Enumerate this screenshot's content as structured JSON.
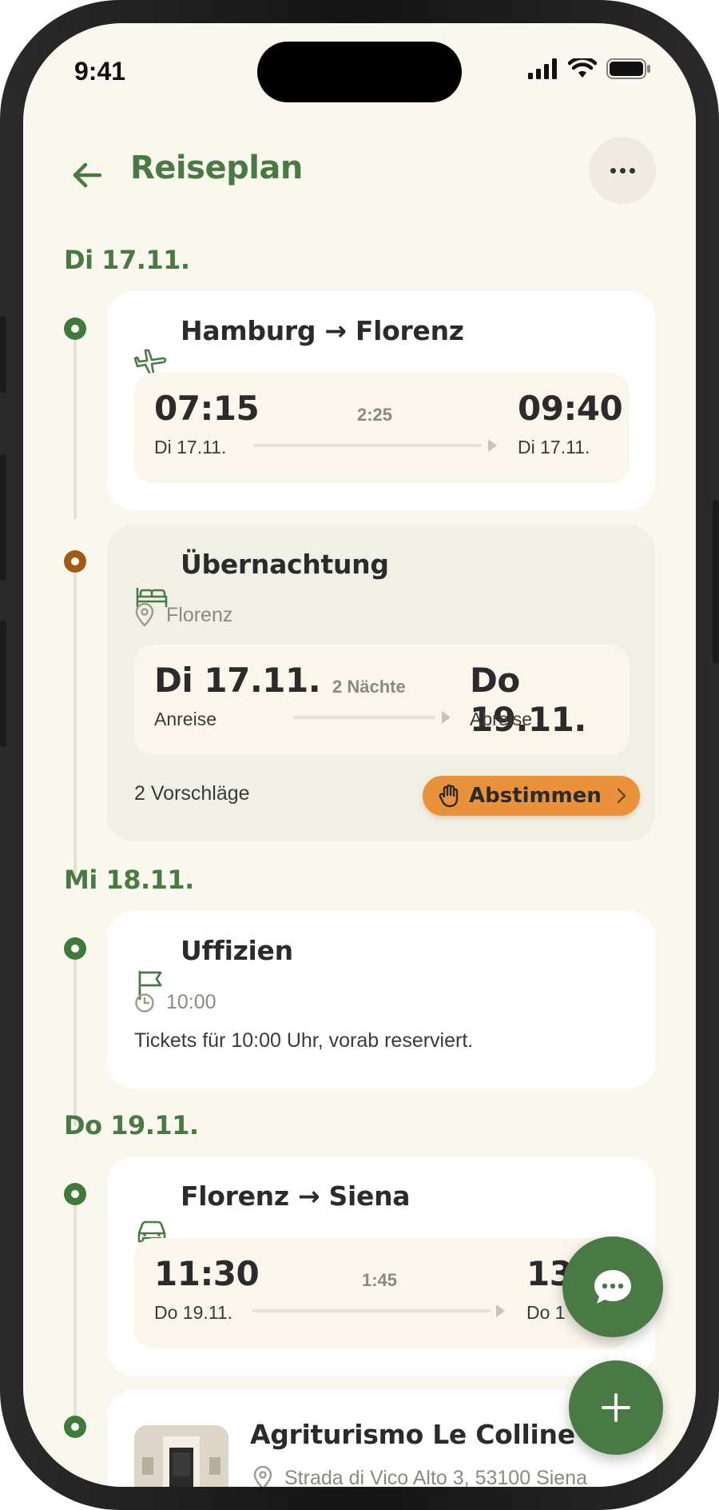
{
  "status": {
    "time": "9:41"
  },
  "header": {
    "title": "Reiseplan"
  },
  "days": [
    {
      "label": "Di 17.11."
    },
    {
      "label": "Mi 18.11."
    },
    {
      "label": "Do 19.11."
    }
  ],
  "items": {
    "flight": {
      "title": "Hamburg → Florenz",
      "icon": "plane-icon",
      "dep_time": "07:15",
      "dep_date": "Di 17.11.",
      "duration": "2:25",
      "arr_time": "09:40",
      "arr_date": "Di 17.11."
    },
    "stay": {
      "title": "Übernachtung",
      "icon": "bed-icon",
      "location": "Florenz",
      "checkin_date": "Di 17.11.",
      "checkin_label": "Anreise",
      "nights": "2 Nächte",
      "checkout_date": "Do 19.11.",
      "checkout_label": "Abreise",
      "suggestions": "2 Vorschläge",
      "vote_label": "Abstimmen"
    },
    "museum": {
      "title": "Uffizien",
      "icon": "flag-icon",
      "time": "10:00",
      "note": "Tickets für 10:00 Uhr, vorab reserviert."
    },
    "drive": {
      "title": "Florenz → Siena",
      "icon": "car-icon",
      "dep_time": "11:30",
      "dep_date": "Do 19.11.",
      "duration": "1:45",
      "arr_time": "13",
      "arr_date": "Do 1"
    },
    "hotel": {
      "title": "Agriturismo Le Colline",
      "address": "Strada di Vico Alto 3, 53100 Siena"
    }
  },
  "colors": {
    "accent": "#4a7a43",
    "orange": "#e9923a",
    "background": "#faf7ef"
  }
}
